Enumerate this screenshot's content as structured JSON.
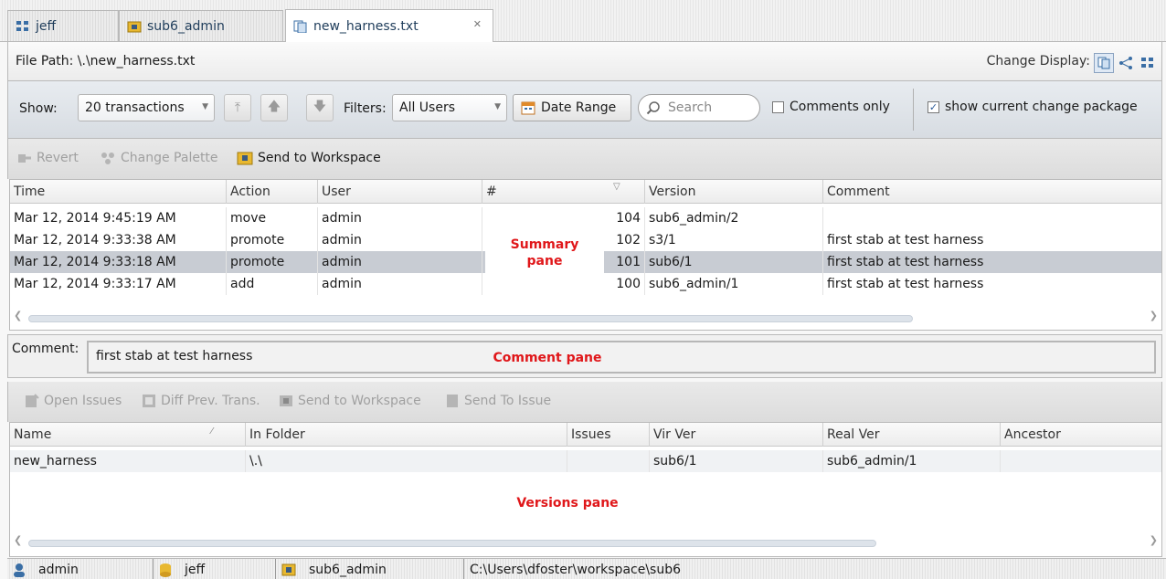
{
  "tabs": [
    {
      "label": "jeff",
      "icon": "stream-icon"
    },
    {
      "label": "sub6_admin",
      "icon": "workspace-icon"
    },
    {
      "label": "new_harness.txt",
      "icon": "history-icon",
      "active": true
    }
  ],
  "file_path": {
    "label": "File Path: \\.\\new_harness.txt",
    "change_display_label": "Change Display:"
  },
  "toolbar": {
    "show_label": "Show:",
    "show_value": "20 transactions",
    "filters_label": "Filters:",
    "filters_value": "All Users",
    "date_range_label": "Date Range",
    "search_placeholder": "Search",
    "comments_only_label": "Comments only",
    "comments_only_checked": false,
    "show_current_cp_label": "show current change package",
    "show_current_cp_checked": true
  },
  "actions": {
    "revert": "Revert",
    "change_palette": "Change Palette",
    "send_to_workspace": "Send to Workspace"
  },
  "summary": {
    "columns": [
      "Time",
      "Action",
      "User",
      "#",
      "Version",
      "Comment"
    ],
    "rows": [
      {
        "time": "Mar 12, 2014 9:45:19 AM",
        "action": "move",
        "user": "admin",
        "num": "104",
        "version": "sub6_admin/2",
        "comment": ""
      },
      {
        "time": "Mar 12, 2014 9:33:38 AM",
        "action": "promote",
        "user": "admin",
        "num": "102",
        "version": "s3/1",
        "comment": "first stab at test harness"
      },
      {
        "time": "Mar 12, 2014 9:33:18 AM",
        "action": "promote",
        "user": "admin",
        "num": "101",
        "version": "sub6/1",
        "comment": "first stab at test harness",
        "selected": true
      },
      {
        "time": "Mar 12, 2014 9:33:17 AM",
        "action": "add",
        "user": "admin",
        "num": "100",
        "version": "sub6_admin/1",
        "comment": "first stab at test harness"
      }
    ],
    "annotation_line1": "Summary",
    "annotation_line2": "pane"
  },
  "comment": {
    "label": "Comment:",
    "value": "first stab at test harness",
    "annotation": "Comment pane"
  },
  "version_actions": {
    "open_issues": "Open Issues",
    "diff_prev": "Diff Prev. Trans.",
    "send_to_workspace": "Send to Workspace",
    "send_to_issue": "Send To Issue"
  },
  "versions": {
    "columns": [
      "Name",
      "In Folder",
      "Issues",
      "Vir Ver",
      "Real Ver",
      "Ancestor"
    ],
    "rows": [
      {
        "name": "new_harness",
        "folder": "\\.\\",
        "issues": "",
        "vir": "sub6/1",
        "real": "sub6_admin/1",
        "ancestor": ""
      }
    ],
    "annotation": "Versions pane"
  },
  "status": {
    "user": "admin",
    "stream": "jeff",
    "workspace": "sub6_admin",
    "path": "C:\\Users\\dfoster\\workspace\\sub6"
  },
  "colors": {
    "annotation": "#e0171a",
    "selected_row": "#c8ccd3"
  }
}
